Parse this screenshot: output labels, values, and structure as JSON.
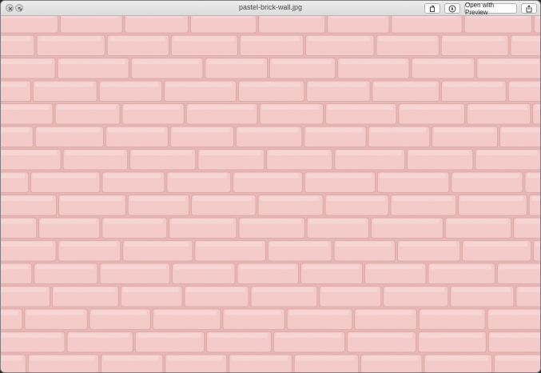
{
  "window": {
    "title": "pastel-brick-wall.jpg"
  },
  "toolbar": {
    "rotate_icon": "rotate-icon",
    "markup_icon": "markup-pen-icon",
    "open_with_label": "Open with Preview",
    "share_icon": "share-icon"
  },
  "image": {
    "subject": "pastel pink brick wall",
    "colors": {
      "brick": "#f6cdcb",
      "brick_highlight": "#fbe0de",
      "mortar_shadow": "#d9a9a7"
    }
  }
}
